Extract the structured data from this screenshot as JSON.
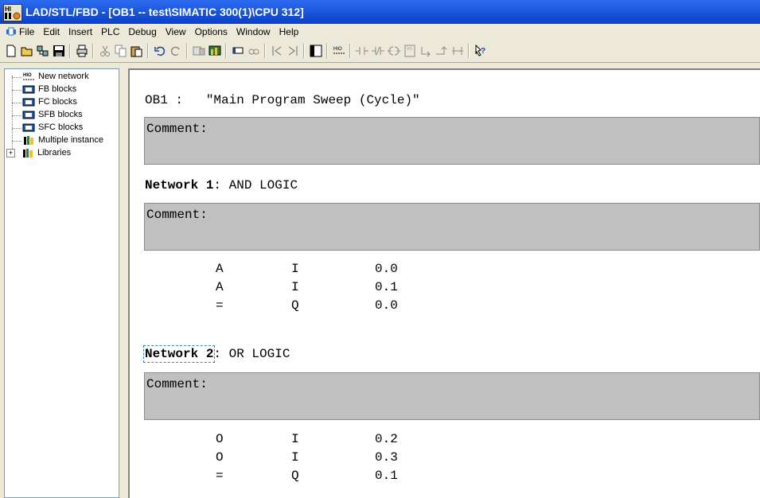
{
  "window": {
    "title": "LAD/STL/FBD  - [OB1 -- test\\SIMATIC 300(1)\\CPU 312]",
    "icon_text": "HI\nI"
  },
  "menu": [
    "File",
    "Edit",
    "Insert",
    "PLC",
    "Debug",
    "View",
    "Options",
    "Window",
    "Help"
  ],
  "toolbar_icons": [
    "new-icon",
    "open-icon",
    "accessible-nodes-icon",
    "save-icon",
    "print-icon",
    "cut-icon",
    "copy-icon",
    "paste-icon",
    "undo-icon",
    "redo-icon",
    "download-icon",
    "monitor-icon",
    "comment-icon",
    "glasses-icon",
    "previous-icon",
    "next-icon",
    "overview-icon",
    "new-network-icon",
    "contact-no-icon",
    "contact-nc-icon",
    "coil-icon",
    "box-icon",
    "branch-open-icon",
    "branch-close-icon",
    "connection-icon",
    "help-icon"
  ],
  "tree": {
    "items": [
      {
        "label": "New network",
        "icon": "network-icon"
      },
      {
        "label": "FB blocks",
        "icon": "block-icon"
      },
      {
        "label": "FC blocks",
        "icon": "block-icon"
      },
      {
        "label": "SFB blocks",
        "icon": "block-icon"
      },
      {
        "label": "SFC blocks",
        "icon": "block-icon"
      },
      {
        "label": "Multiple instance",
        "icon": "library-icon"
      },
      {
        "label": "Libraries",
        "icon": "library-icon",
        "expander": "+"
      }
    ]
  },
  "editor": {
    "block_header": "OB1 :   \"Main Program Sweep (Cycle)\"",
    "comment_label": "Comment:",
    "networks": [
      {
        "label": "Network 1",
        "title": ": AND LOGIC",
        "comment": "Comment:",
        "statements": [
          {
            "op": "A",
            "area": "I",
            "addr": "0.0"
          },
          {
            "op": "A",
            "area": "I",
            "addr": "0.1"
          },
          {
            "op": "=",
            "area": "Q",
            "addr": "0.0"
          }
        ]
      },
      {
        "label": "Network 2",
        "title": ": OR LOGIC",
        "comment": "Comment:",
        "statements": [
          {
            "op": "O",
            "area": "I",
            "addr": "0.2"
          },
          {
            "op": "O",
            "area": "I",
            "addr": "0.3"
          },
          {
            "op": "=",
            "area": "Q",
            "addr": "0.1"
          }
        ]
      }
    ]
  }
}
